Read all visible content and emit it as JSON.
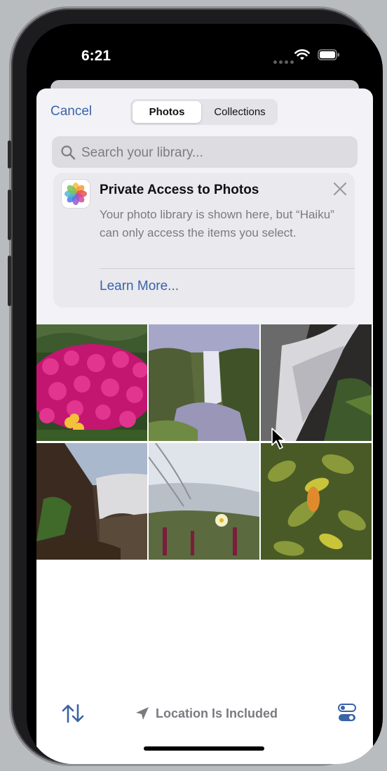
{
  "status_bar": {
    "time": "6:21"
  },
  "header": {
    "cancel_label": "Cancel",
    "segments": [
      {
        "label": "Photos",
        "selected": true
      },
      {
        "label": "Collections",
        "selected": false
      }
    ]
  },
  "search": {
    "placeholder": "Search your library...",
    "value": ""
  },
  "privacy_card": {
    "title": "Private Access to Photos",
    "body": "Your photo library is shown here, but “Haiku” can only access the items you select.",
    "link": "Learn More..."
  },
  "photos": [
    {
      "icon": "flowers-photo"
    },
    {
      "icon": "waterfall-photo"
    },
    {
      "icon": "waterfall-closeup-photo"
    },
    {
      "icon": "cliff-waterfall-photo"
    },
    {
      "icon": "grass-flower-photo"
    },
    {
      "icon": "leaves-photo"
    }
  ],
  "toolbar": {
    "location_label": "Location Is Included"
  },
  "colors": {
    "accent": "#3a63a8",
    "sheet_bg": "#f2f2f7",
    "secondary_text": "#7a7a80"
  }
}
